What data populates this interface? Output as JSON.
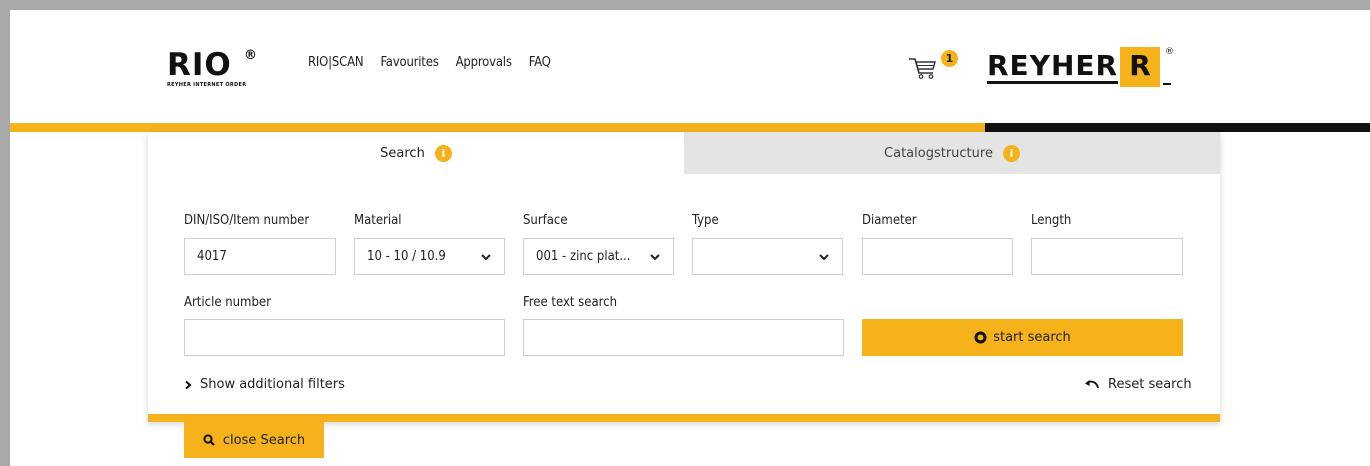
{
  "brand": {
    "rio": "RIO",
    "rio_reg": "®",
    "rio_sub": "REYHER INTERNET ORDER",
    "reyher": "REYHER",
    "reyher_box": "R",
    "reyher_reg": "®",
    "accent": "#f5b21b"
  },
  "nav": [
    "RIO|SCAN",
    "Favourites",
    "Approvals",
    "FAQ"
  ],
  "cart": {
    "icon": "cart-icon",
    "count": "1"
  },
  "tabs": {
    "search": "Search",
    "catalog": "Catalogstructure",
    "info_glyph": "i"
  },
  "fields": {
    "din": {
      "label": "DIN/ISO/Item number",
      "value": "4017"
    },
    "material": {
      "label": "Material",
      "value": "10 - 10 / 10.9"
    },
    "surface": {
      "label": "Surface",
      "value": "001 - zinc plat..."
    },
    "type": {
      "label": "Type",
      "value": ""
    },
    "diameter": {
      "label": "Diameter",
      "value": ""
    },
    "length": {
      "label": "Length",
      "value": ""
    },
    "article": {
      "label": "Article number",
      "value": ""
    },
    "freetext": {
      "label": "Free text search",
      "value": ""
    }
  },
  "actions": {
    "start_search": "start search",
    "show_filters": "Show additional filters",
    "reset": "Reset search",
    "close_search": "close Search"
  }
}
